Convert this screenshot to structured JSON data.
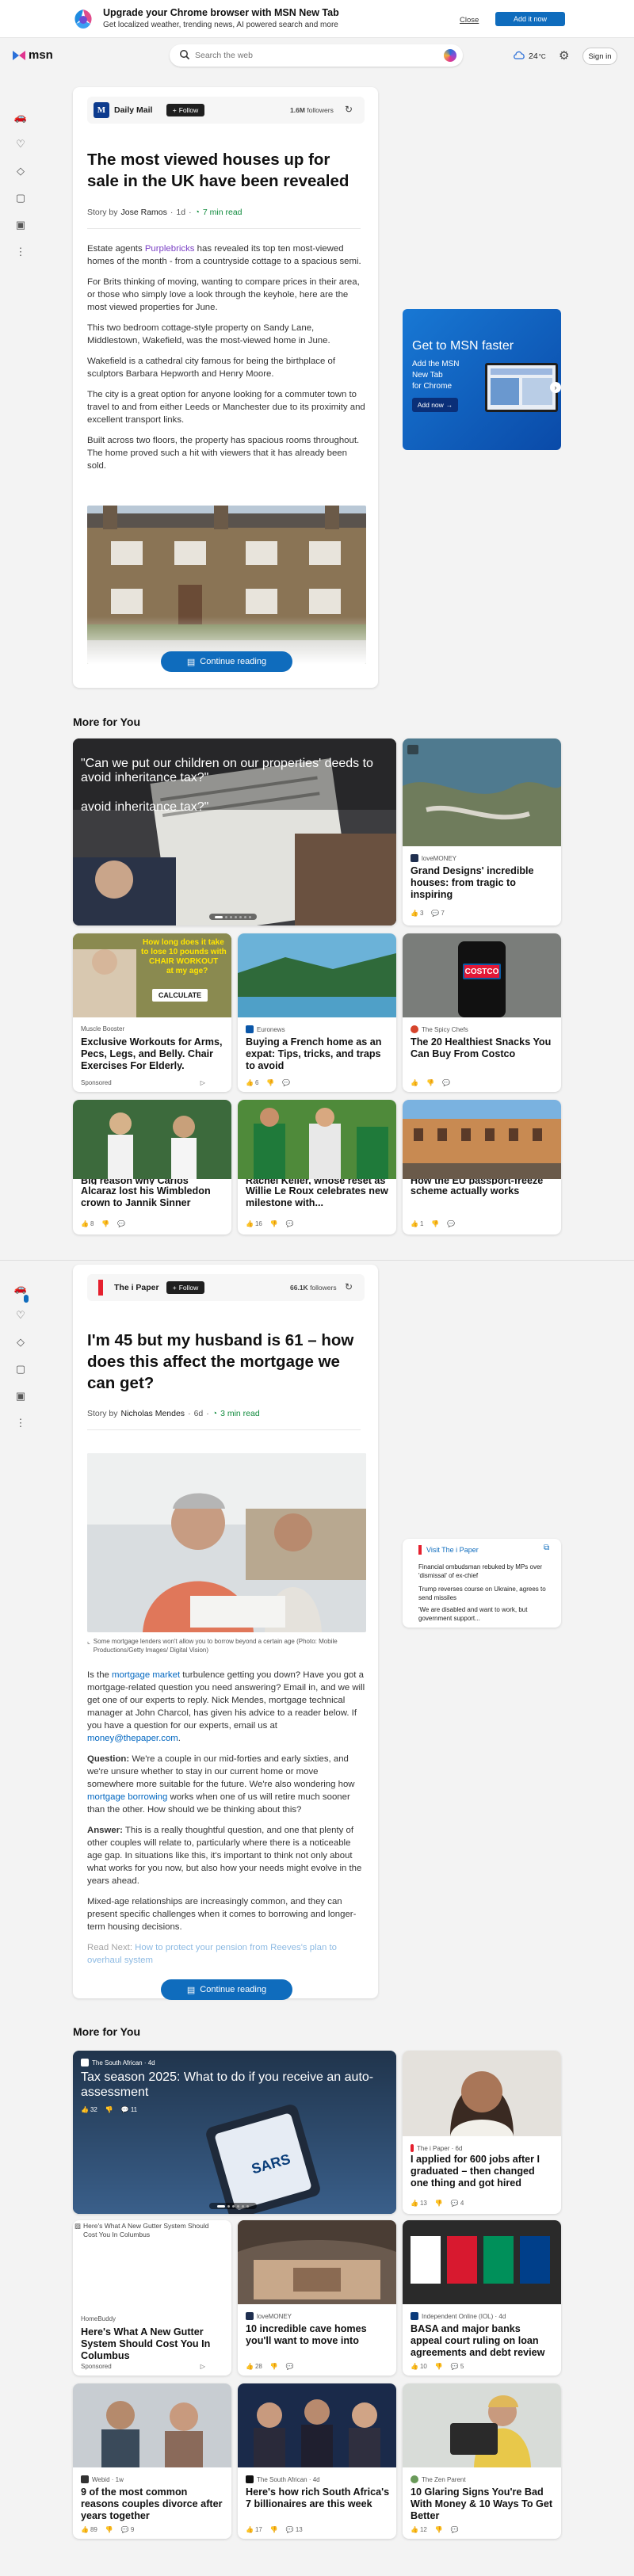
{
  "banner": {
    "title": "Upgrade your Chrome browser with MSN New Tab",
    "subtitle": "Get localized weather, trending news, AI powered search and more",
    "close": "Close",
    "add": "Add it now"
  },
  "nav": {
    "logo": "msn",
    "search_placeholder": "Search the web",
    "weather": "24",
    "weather_unit": "°C",
    "signin": "Sign in"
  },
  "colors": {
    "accent": "#0f6cbd",
    "dark_overlay": "#1f1f1f"
  },
  "article1": {
    "publisher": "Daily Mail",
    "follow": "Follow",
    "followers_count": "1.6M",
    "followers_label": "followers",
    "title": "The most viewed houses up for sale in the UK have been revealed",
    "story_by": "Story by",
    "author": "Jose Ramos",
    "age": "1d",
    "read_time": "7 min read",
    "p1_a": "Estate agents ",
    "p1_link": "Purplebricks",
    "p1_b": " has revealed its top ten most-viewed homes of the month - from a countryside cottage to a spacious semi.",
    "p2": "For Brits thinking of moving, wanting to compare prices in their area, or those who simply love a look through the keyhole, here are the most viewed properties for June.",
    "p3": "This two bedroom cottage-style property on Sandy Lane, Middlestown, Wakefield, was the most-viewed home in June.",
    "p4": "Wakefield is a cathedral city famous for being the birthplace of sculptors Barbara Hepworth and Henry Moore.",
    "p5": "The city is a great option for anyone looking for a commuter town to travel to and from either Leeds or Manchester due to its proximity and excellent transport links.",
    "p6": "Built across two floors, the property has spacious rooms throughout. The home proved such a hit with viewers that it has already been sold.",
    "continue": "Continue reading"
  },
  "ad": {
    "title": "Get to MSN faster",
    "line1": "Add the MSN",
    "line2": "New Tab",
    "line3": "for Chrome",
    "button": "Add now"
  },
  "more1": {
    "heading": "More for You",
    "feature": {
      "line1": "\"Can we put our children on our properties' deeds to",
      "line2": "avoid inheritance tax?\"",
      "line3": "avoid inheritance tax?\""
    },
    "cards": [
      {
        "source": "loveMONEY",
        "title": "Grand Designs' incredible houses: from tragic to inspiring",
        "likes": "3",
        "comments": "7"
      },
      {
        "source": "Muscle Booster",
        "title": "Exclusive Workouts for Arms, Pecs, Legs, and Belly. Chair Exercises For Elderly.",
        "sponsored": "Sponsored",
        "ad_line1": "How long does it take",
        "ad_line2": "to lose 10 pounds with",
        "ad_line3": "CHAIR WORKOUT",
        "ad_line4": "at my age?",
        "ad_cta": "CALCULATE"
      },
      {
        "source": "Euronews",
        "title": "Buying a French home as an expat: Tips, tricks, and traps to avoid",
        "likes": "6"
      },
      {
        "source": "The Spicy Chefs",
        "title": "The 20 Healthiest Snacks You Can Buy From Costco",
        "logo_text": "COSTCO"
      },
      {
        "title_top": "Big reason why Carlos",
        "title": "Alcaraz lost his Wimbledon crown to Jannik Sinner",
        "likes": "8"
      },
      {
        "title_top": "Rachel Keller, whose reset as",
        "title": "Willie Le Roux celebrates new milestone with...",
        "likes": "16"
      },
      {
        "title_top": "How the EU passport-freeze",
        "title": "scheme actually works",
        "likes": "1"
      }
    ]
  },
  "article2": {
    "publisher": "The i Paper",
    "follow": "Follow",
    "followers_count": "66.1K",
    "followers_label": "followers",
    "title": "I'm 45 but my husband is 61 – how does this affect the mortgage we can get?",
    "story_by": "Story by",
    "author": "Nicholas Mendes",
    "age": "6d",
    "read_time": "3 min read",
    "caption": "Some mortgage lenders won't allow you to borrow beyond a certain age (Photo: Mobile Productions/Getty Images/ Digital Vision)",
    "p1_a": "Is the ",
    "p1_link1": "mortgage market",
    "p1_b": " turbulence getting you down? Have you got a mortgage-related question you need answering? Email in, and we will get one of our experts to reply. Nick Mendes, mortgage technical manager at John Charcol, has given his advice to a reader below. If you have a question for our experts, email us at ",
    "p1_link2": "money@thepaper.com",
    "p1_c": ".",
    "q_label": "Question:",
    "q_a": " We're a couple in our mid-forties and early sixties, and we're unsure whether to stay in our current home or move somewhere more suitable for the future. We're also wondering how ",
    "q_link": "mortgage borrowing",
    "q_b": " works when one of us will retire much sooner than the other. How should we be thinking about this?",
    "a_label": "Answer:",
    "a_text": " This is a really thoughtful question, and one that plenty of other couples will relate to, particularly where there is a noticeable age gap. In situations like this, it's important to think not only about what works for you now, but also how your needs might evolve in the years ahead.",
    "p_mixed": "Mixed-age relationships are increasingly common, and they can present specific challenges when it comes to borrowing and longer-term housing decisions.",
    "readnext_label": "Read Next: ",
    "readnext_link": "How to protect your pension from Reeves's plan to overhaul system",
    "continue": "Continue reading"
  },
  "side2": {
    "visit": "Visit The i Paper",
    "items": [
      "Financial ombudsman rebuked by MPs over 'dismissal' of ex-chief",
      "Trump reverses course on Ukraine, agrees to send missiles",
      "'We are disabled and want to work, but government support..."
    ]
  },
  "more2": {
    "heading": "More for You",
    "feature": {
      "source": "The South African · 4d",
      "title": "Tax season 2025: What to do if you receive an auto-assessment",
      "likes": "32",
      "comments": "11",
      "brand": "SARS"
    },
    "cards": [
      {
        "source": "The i Paper · 6d",
        "title": "I applied for 600 jobs after I graduated – then changed one thing and got hired",
        "likes": "13",
        "comments": "4"
      },
      {
        "img_alt": "Here's What A New Gutter System Should Cost You In Columbus",
        "source": "HomeBuddy",
        "title": "Here's What A New Gutter System Should Cost You In Columbus",
        "sponsored": "Sponsored"
      },
      {
        "source": "loveMONEY",
        "title": "10 incredible cave homes you'll want to move into",
        "likes": "28"
      },
      {
        "source": "Independent Online (IOL) · 4d",
        "title": "BASA and major banks appeal court ruling on loan agreements and debt review",
        "likes": "10",
        "comments": "5"
      },
      {
        "source": "Webid · 1w",
        "title": "9 of the most common reasons couples divorce after years together",
        "likes": "89",
        "comments": "9"
      },
      {
        "source": "The South African · 4d",
        "title": "Here's how rich South Africa's 7 billionaires are this week",
        "likes": "17",
        "comments": "13"
      },
      {
        "source": "The Zen Parent",
        "title": "10 Glaring Signs You're Bad With Money & 10 Ways To Get Better",
        "likes": "12"
      }
    ]
  }
}
